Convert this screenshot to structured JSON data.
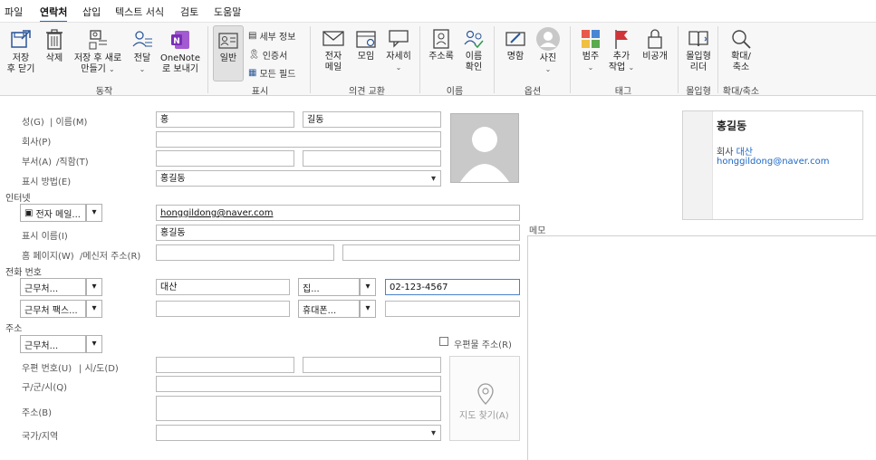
{
  "menu": {
    "tabs": [
      "파일",
      "연락처",
      "삽입",
      "텍스트 서식",
      "검토",
      "도움말"
    ],
    "active": "연락처"
  },
  "ribbon": {
    "save_close": [
      "저장",
      "후 닫기"
    ],
    "delete": "삭제",
    "save_new": [
      "저장 후 새로",
      "만들기"
    ],
    "forward": "전달",
    "onenote": [
      "OneNote",
      "로 보내기"
    ],
    "group_actions": "동작",
    "general": "일반",
    "details": "세부 정보",
    "certificates": "인증서",
    "all_fields": "모든 필드",
    "group_show": "표시",
    "email": [
      "전자",
      "메일"
    ],
    "meeting": "모임",
    "more": "자세히",
    "group_communicate": "의견 교환",
    "address_book": "주소록",
    "check_names": [
      "이름",
      "확인"
    ],
    "group_names": "이름",
    "business_card": "명함",
    "picture": "사진",
    "group_options": "옵션",
    "categorize": "범주",
    "follow_up": [
      "추가",
      "작업"
    ],
    "private": "비공개",
    "group_tags": "태그",
    "immersive_reader": [
      "몰입형",
      "리더"
    ],
    "group_immersive": "몰입형",
    "zoom": [
      "확대/",
      "축소"
    ],
    "group_zoom": "확대/축소"
  },
  "form": {
    "last_name_label": "성(G)",
    "first_name_label": "| 이름(M)",
    "last_name": "홍",
    "first_name": "길동",
    "company_label": "회사(P)",
    "company": "",
    "department_label": "부서(A)",
    "jobtitle_label": "/직함(T)",
    "file_as_label": "표시 방법(E)",
    "file_as": "홍길동",
    "internet_section": "인터넷",
    "email_type": "전자 메일...",
    "email": "honggildong@naver.com",
    "display_as_label": "표시 이름(I)",
    "display_as": "홍길동",
    "webpage_label": "홈 페이지(W)",
    "im_label": "/메신저 주소(R)",
    "phone_section": "전화 번호",
    "phone1_type": "근무처...",
    "phone1_value": "대산",
    "phone2_type": "집...",
    "phone2_value": "02-123-4567",
    "phone3_type": "근무처 팩스...",
    "phone3_value": "",
    "phone4_type": "휴대폰...",
    "phone4_value": "",
    "address_section": "주소",
    "address_type": "근무처...",
    "mailing_address_label": "우편물 주소(R)",
    "postal_label": "우편 번호(U)",
    "city_label": "| 시/도(D)",
    "district_label": "구/군/시(Q)",
    "street_label": "주소(B)",
    "country_label": "국가/지역",
    "map_label": "지도 찾기(A)"
  },
  "card": {
    "name": "홍길동",
    "company_prefix": "회사",
    "company": "대산",
    "email": "honggildong@naver.com"
  },
  "notes_label": "메모",
  "colors": {
    "accent": "#1d67c4",
    "onenote": "#7b2fb5",
    "flag": "#d13438"
  }
}
